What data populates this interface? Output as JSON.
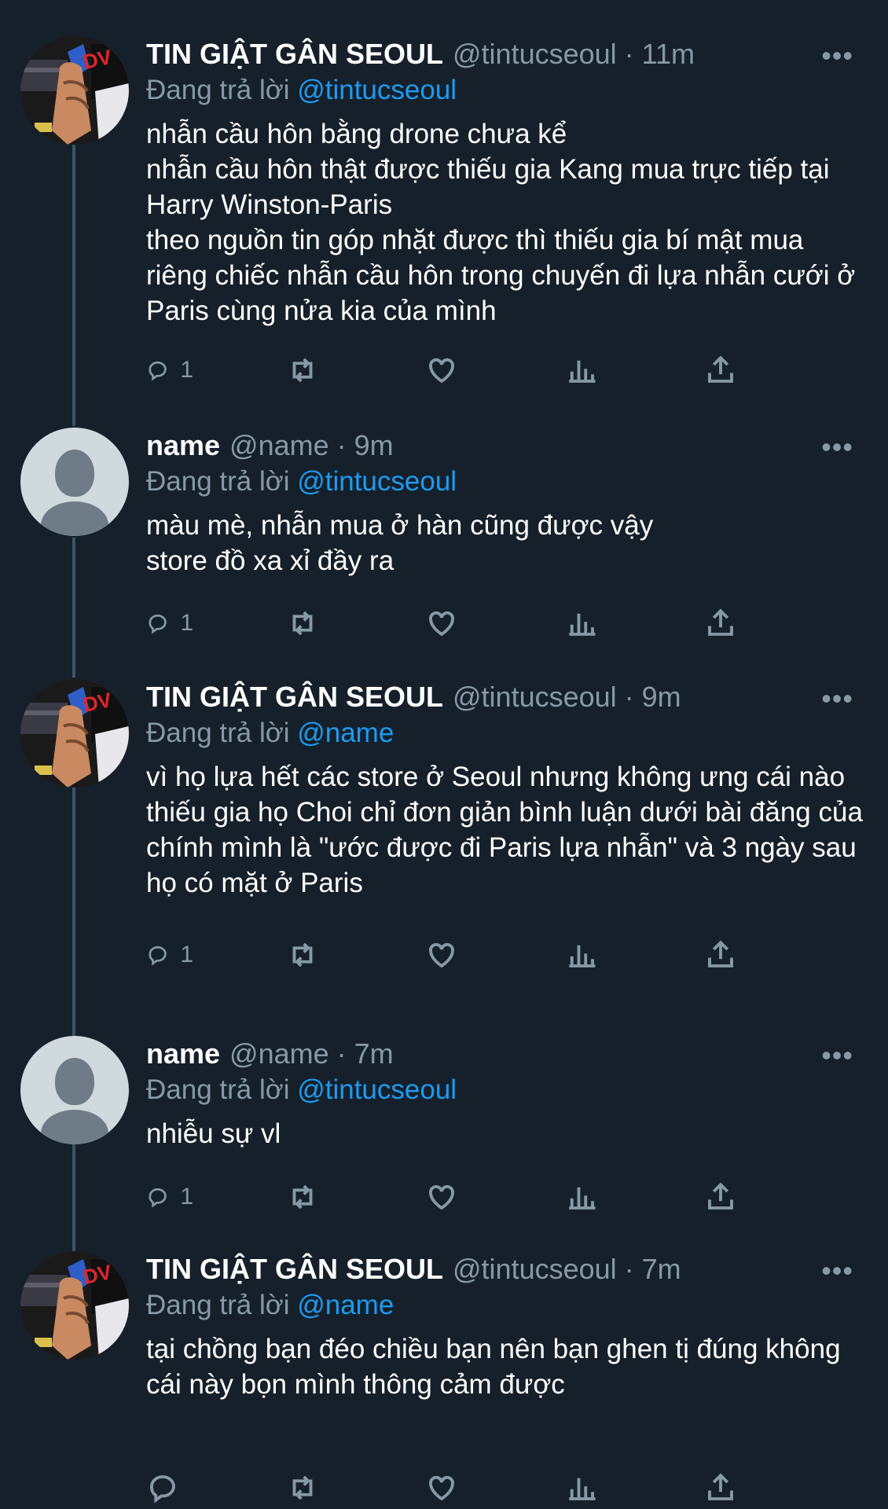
{
  "tweets": [
    {
      "display_name": "TIN GIẬT GÂN SEOUL",
      "handle_time": "@tintucseoul · 11m",
      "reply_prefix": "Đang trả lời",
      "reply_to": "@tintucseoul",
      "text": "nhẫn cầu hôn bằng drone chưa kể\nnhẫn cầu hôn thật được thiếu gia Kang mua trực tiếp tại Harry Winston-Paris\ntheo nguồn tin góp nhặt được thì thiếu gia bí mật mua riêng chiếc nhẫn cầu hôn trong chuyến đi lựa nhẫn cưới ở Paris cùng nửa kia của mình",
      "reply_count": "1",
      "avatar": "page-avatar-photo"
    },
    {
      "display_name": "name",
      "handle_time": "@name · 9m",
      "reply_prefix": "Đang trả lời",
      "reply_to": "@tintucseoul",
      "text": "màu mè, nhẫn mua ở hàn cũng được vậy\nstore đồ xa xỉ đầy ra",
      "reply_count": "1",
      "avatar": "default-avatar"
    },
    {
      "display_name": "TIN GIẬT GÂN SEOUL",
      "handle_time": "@tintucseoul · 9m",
      "reply_prefix": "Đang trả lời",
      "reply_to": "@name",
      "text": "vì họ lựa hết các store ở Seoul nhưng không ưng cái nào\nthiếu gia họ Choi chỉ đơn giản bình luận dưới bài đăng của chính mình là \"ước được đi Paris lựa nhẫn\" và 3 ngày sau họ có mặt ở Paris",
      "reply_count": "1",
      "avatar": "page-avatar-photo"
    },
    {
      "display_name": "name",
      "handle_time": "@name · 7m",
      "reply_prefix": "Đang trả lời",
      "reply_to": "@tintucseoul",
      "text": "nhiễu sự vl",
      "reply_count": "1",
      "avatar": "default-avatar"
    },
    {
      "display_name": "TIN GIẬT GÂN SEOUL",
      "handle_time": "@tintucseoul · 7m",
      "reply_prefix": "Đang trả lời",
      "reply_to": "@name",
      "text": "tại chồng bạn đéo chiều bạn nên bạn ghen tị đúng không\ncái này bọn mình thông cảm được",
      "reply_count": "",
      "avatar": "page-avatar-photo"
    }
  ],
  "colors": {
    "background": "#15202b",
    "secondary_text": "#8899a6",
    "link": "#1d9bf0",
    "thread_line": "#3d5466"
  }
}
